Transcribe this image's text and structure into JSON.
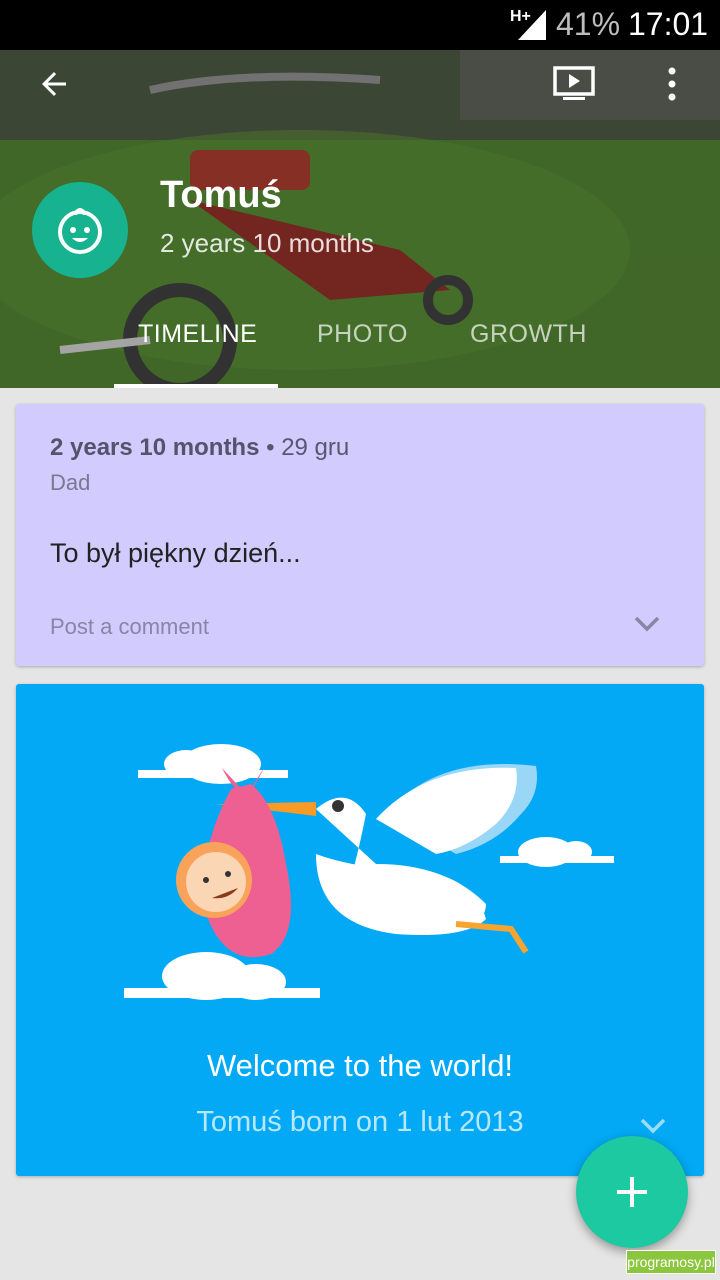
{
  "status_bar": {
    "network": "H+",
    "battery": "41%",
    "time": "17:01"
  },
  "header": {
    "name": "Tomuś",
    "age": "2 years 10 months",
    "tabs": [
      "TIMELINE",
      "PHOTO",
      "GROWTH"
    ],
    "active_tab": "TIMELINE"
  },
  "post": {
    "age": "2 years 10 months",
    "separator": " • ",
    "date": "29 gru",
    "author": "Dad",
    "text": "To był piękny dzień...",
    "comment_placeholder": "Post a comment"
  },
  "birth_card": {
    "title": "Welcome to the world!",
    "subtitle": "Tomuś born on 1 lut 2013"
  },
  "watermark": "programosy.pl",
  "colors": {
    "accent": "#1dc9a1",
    "avatar_bg": "#17b290",
    "post_card_bg": "#d2cbfd",
    "birth_card_bg": "#03a9f4",
    "page_bg": "#e5e5e5"
  },
  "icons": {
    "back": "arrow-back-icon",
    "slideshow": "slideshow-icon",
    "more": "more-vert-icon",
    "avatar": "baby-face-icon",
    "expand": "chevron-down-icon",
    "fab": "plus-icon"
  }
}
